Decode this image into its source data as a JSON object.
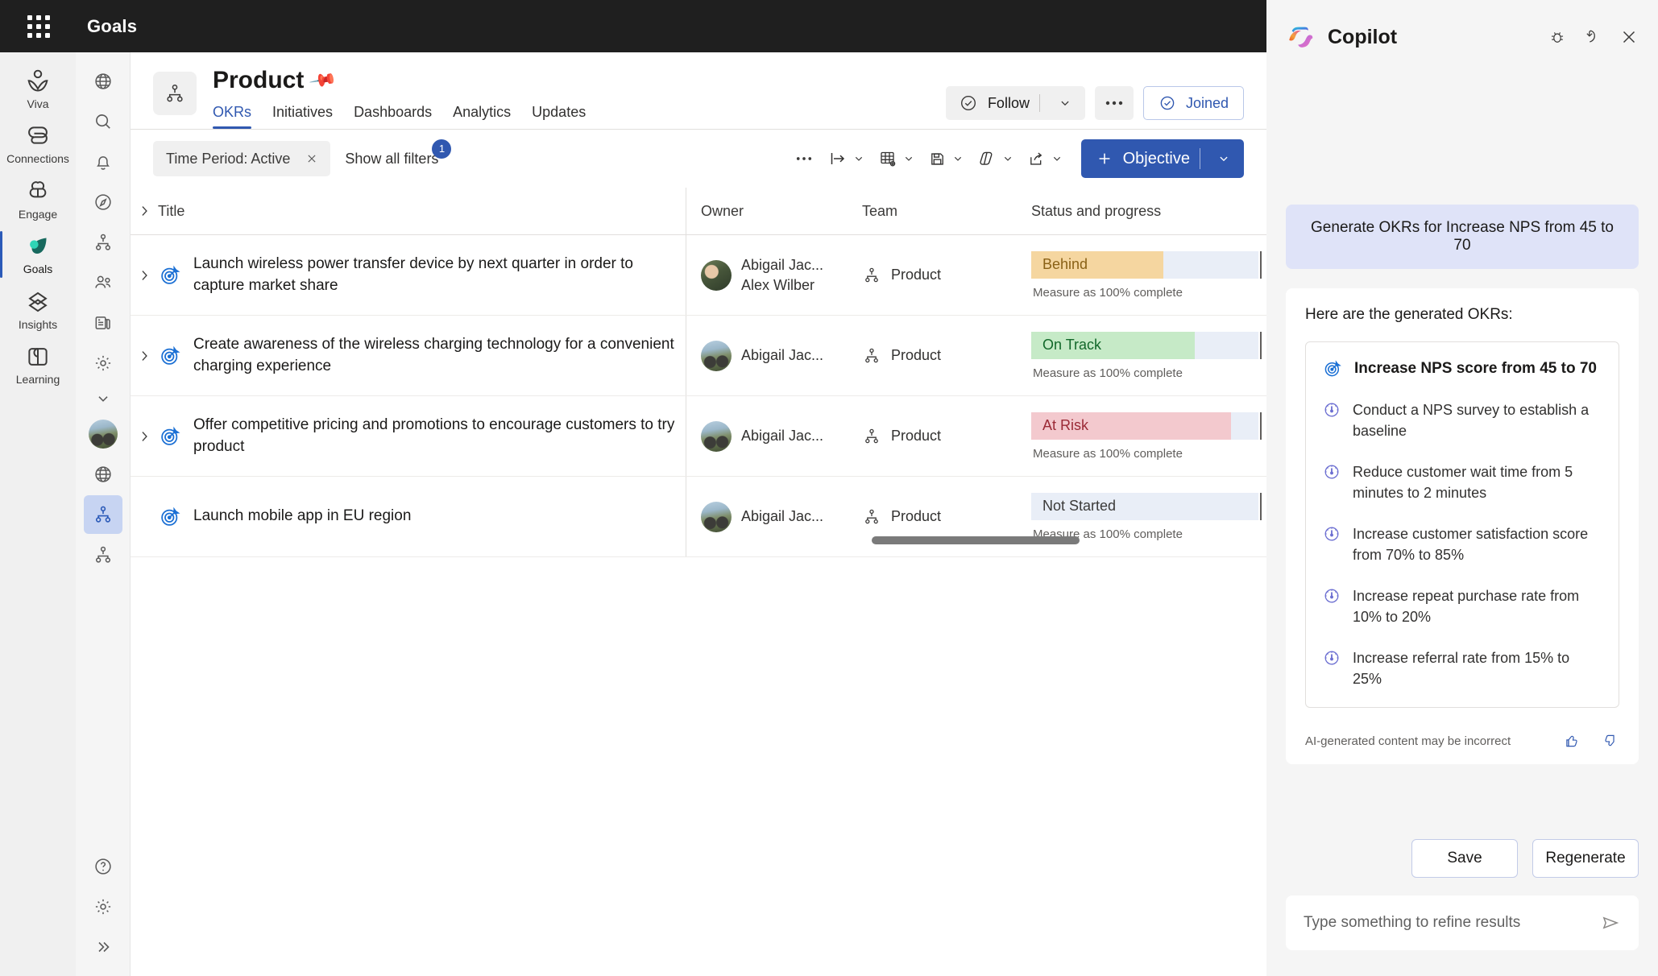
{
  "topbar": {
    "app_title": "Goals",
    "waffle_icon": "app-launcher-grid-icon"
  },
  "rail_left": {
    "items": [
      {
        "label": "Viva",
        "icon": "viva-person-icon",
        "active": false
      },
      {
        "label": "Connections",
        "icon": "connections-link-icon",
        "active": false
      },
      {
        "label": "Engage",
        "icon": "engage-clover-icon",
        "active": false
      },
      {
        "label": "Goals",
        "icon": "goals-leaf-icon",
        "active": true
      },
      {
        "label": "Insights",
        "icon": "insights-layers-icon",
        "active": false
      },
      {
        "label": "Learning",
        "icon": "learning-book-icon",
        "active": false
      }
    ]
  },
  "rail_second": {
    "items": [
      {
        "icon": "globe-icon",
        "selected": false
      },
      {
        "icon": "search-icon",
        "selected": false
      },
      {
        "icon": "bell-icon",
        "selected": false
      },
      {
        "icon": "compass-icon",
        "selected": false
      },
      {
        "icon": "org-hierarchy-icon",
        "selected": false
      },
      {
        "icon": "people-icon",
        "selected": false
      },
      {
        "icon": "news-feed-icon",
        "selected": false
      },
      {
        "icon": "gear-icon",
        "selected": false
      },
      {
        "icon": "chevron-down-icon",
        "selected": false
      },
      {
        "icon": "user-avatar-icon",
        "selected": false
      },
      {
        "icon": "globe-icon",
        "selected": false
      },
      {
        "icon": "org-hierarchy-icon",
        "selected": true
      },
      {
        "icon": "org-hierarchy-icon",
        "selected": false
      }
    ],
    "bottom": [
      {
        "icon": "help-question-icon"
      },
      {
        "icon": "gear-icon"
      },
      {
        "icon": "double-chevron-right-icon"
      }
    ]
  },
  "page": {
    "title": "Product",
    "pin_icon": "pin-icon",
    "team_icon": "org-hierarchy-icon",
    "tabs": [
      {
        "label": "OKRs",
        "selected": true
      },
      {
        "label": "Initiatives",
        "selected": false
      },
      {
        "label": "Dashboards",
        "selected": false
      },
      {
        "label": "Analytics",
        "selected": false
      },
      {
        "label": "Updates",
        "selected": false
      }
    ],
    "follow_label": "Follow",
    "follow_icon": "check-circle-icon",
    "follow_caret_icon": "chevron-down-icon",
    "more_icon": "ellipsis-icon",
    "joined_label": "Joined",
    "joined_icon": "check-circle-icon"
  },
  "toolbar": {
    "filter_chip": "Time Period: Active",
    "filter_chip_clear_icon": "close-icon",
    "show_filters_label": "Show all filters",
    "filter_count": "1",
    "buttons": [
      {
        "icon": "ellipsis-icon",
        "caret": false
      },
      {
        "icon": "expand-rows-icon",
        "caret": true
      },
      {
        "icon": "table-settings-icon",
        "caret": true
      },
      {
        "icon": "save-view-icon",
        "caret": true
      },
      {
        "icon": "copilot-icon",
        "caret": true
      },
      {
        "icon": "share-icon",
        "caret": true
      }
    ],
    "objective_label": "Objective",
    "objective_plus_icon": "plus-icon",
    "objective_caret_icon": "chevron-down-icon",
    "accent_color": "#3058b0"
  },
  "table": {
    "columns": [
      "Title",
      "Owner",
      "Team",
      "Status and progress"
    ],
    "header_chevron_icon": "chevron-right-icon",
    "rows": [
      {
        "title": "Launch wireless power transfer device by next quarter in order to capture market share",
        "icon": "target-objective-icon",
        "expandable": true,
        "owners": [
          "Abigail Jac...",
          "Alex Wilber"
        ],
        "team": "Product",
        "status": "Behind",
        "status_color": "#f5d6a0",
        "status_text_color": "#8a6116",
        "progress_pct": 58,
        "measure": "Measure as 100% complete"
      },
      {
        "title": "Create awareness of the wireless charging technology for a convenient charging experience",
        "icon": "target-objective-icon",
        "expandable": true,
        "owners": [
          "Abigail Jac..."
        ],
        "team": "Product",
        "status": "On Track",
        "status_color": "#c6eac7",
        "status_text_color": "#12682a",
        "progress_pct": 72,
        "measure": "Measure as 100% complete"
      },
      {
        "title": "Offer competitive pricing and promotions to encourage customers to try product",
        "icon": "target-objective-icon",
        "expandable": true,
        "owners": [
          "Abigail Jac..."
        ],
        "team": "Product",
        "status": "At Risk",
        "status_color": "#f3c9ce",
        "status_text_color": "#9b2a36",
        "progress_pct": 88,
        "measure": "Measure as 100% complete"
      },
      {
        "title": "Launch mobile app in EU region",
        "icon": "target-objective-icon",
        "expandable": false,
        "owners": [
          "Abigail Jac..."
        ],
        "team": "Product",
        "status": "Not Started",
        "status_color": "#e9eef7",
        "status_text_color": "#3b3a39",
        "progress_pct": 0,
        "measure": "Measure as 100% complete"
      }
    ]
  },
  "copilot": {
    "title": "Copilot",
    "logo_icon": "copilot-logo-icon",
    "header_icons": [
      {
        "icon": "bug-feedback-icon"
      },
      {
        "icon": "undo-history-icon"
      },
      {
        "icon": "close-icon"
      }
    ],
    "user_prompt": "Generate OKRs for Increase NPS from 45 to 70",
    "response_intro": "Here are the generated OKRs:",
    "objective": {
      "title": "Increase NPS score from 45 to 70",
      "icon": "target-objective-icon"
    },
    "key_results": [
      {
        "text": "Conduct a NPS survey to establish a baseline",
        "icon": "key-result-gauge-icon"
      },
      {
        "text": "Reduce customer wait time from 5 minutes to 2 minutes",
        "icon": "key-result-gauge-icon"
      },
      {
        "text": "Increase customer satisfaction score from 70% to 85%",
        "icon": "key-result-gauge-icon"
      },
      {
        "text": "Increase repeat purchase rate from 10% to 20%",
        "icon": "key-result-gauge-icon"
      },
      {
        "text": "Increase referral rate from 15% to 25%",
        "icon": "key-result-gauge-icon"
      }
    ],
    "disclaimer": "AI-generated content may be incorrect",
    "thumbs_up_icon": "thumbs-up-icon",
    "thumbs_down_icon": "thumbs-down-icon",
    "save_label": "Save",
    "regenerate_label": "Regenerate",
    "input_placeholder": "Type something to refine results",
    "send_icon": "send-icon"
  }
}
